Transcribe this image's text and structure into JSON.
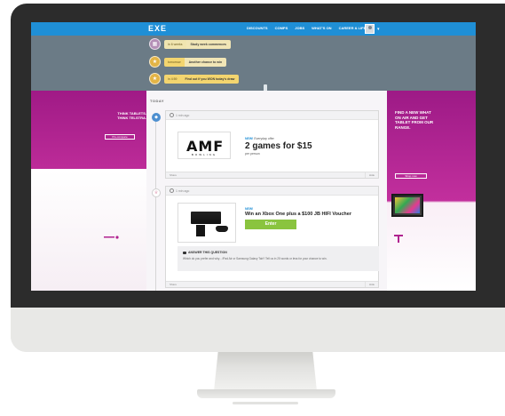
{
  "nav": {
    "logo": "EXE",
    "logo_sub": "",
    "items": [
      "DISCOUNTS",
      "COMPS",
      "JOBS",
      "WHAT'S ON",
      "CAREER & LIFE"
    ],
    "caret": "▾"
  },
  "reminders": [
    {
      "time": "in 6 weeks",
      "text": "Study week commences",
      "circle_color": "#b48fb6",
      "time_color": "#f0e5b0"
    },
    {
      "time": "tomorrow",
      "text": "Another chance to win",
      "circle_color": "#e3b446",
      "time_color": "#f3d56f"
    },
    {
      "time": "in 4:59",
      "text": "Find out if you WON today's draw",
      "circle_color": "#e3b446",
      "time_color": "#f3d56f"
    }
  ],
  "timeline": {
    "today_label": "TODAY"
  },
  "ads": {
    "left_text": "THINK TABLETS. THINK TELSTRA.",
    "left_button": "Pre-compare",
    "right_text": "FIND A NEW WHAT ON AIR AND GET TABLET FROM OUR RANGE.",
    "right_button": "Shop now"
  },
  "cards": [
    {
      "time_ago": "1 min ago",
      "tag_new": "NEW!",
      "tag_type": "Everyday offer",
      "title": "2 games for $15",
      "subtitle": "per person",
      "brand_logo": "AMF",
      "brand_sub": "BOWLING",
      "share": "Share",
      "hide": "Hide"
    },
    {
      "time_ago": "1 min ago",
      "tag_new": "NEW!",
      "title": "Win an Xbox One plus a $100 JB HIFI Voucher",
      "enter_label": "Enter",
      "question_header": "ANSWER THIS QUESTION",
      "question_text": "Which do you prefer and why... iPad Air or Samsung Galaxy Tab? Tell us in 25 words or less for your chance to win.",
      "share": "Share",
      "hide": "Hide"
    }
  ],
  "colors": {
    "nav_blue": "#1f8fd6",
    "header_grey": "#6b7b86",
    "telstra_magenta": "#b0228f",
    "enter_green": "#8ac43f"
  }
}
